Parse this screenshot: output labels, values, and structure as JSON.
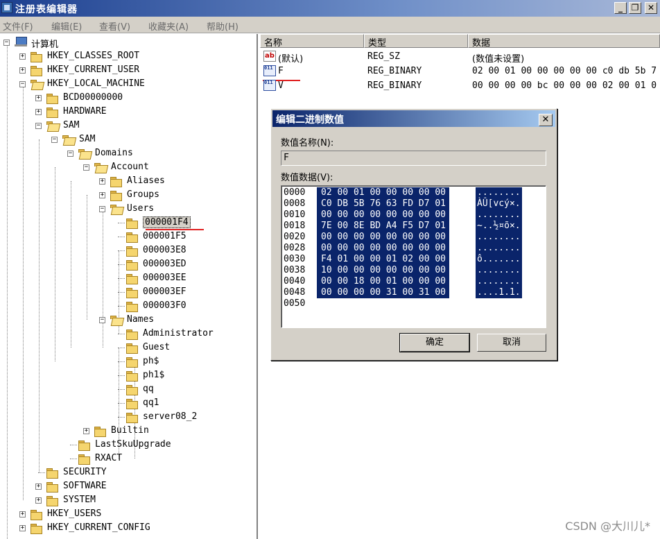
{
  "window": {
    "title": "注册表编辑器"
  },
  "menu": [
    {
      "label": "文件(F)"
    },
    {
      "label": "编辑(E)"
    },
    {
      "label": "查看(V)"
    },
    {
      "label": "收藏夹(A)"
    },
    {
      "label": "帮助(H)"
    }
  ],
  "tree": [
    {
      "label": "计算机",
      "icon": "computer-icon",
      "expander": "−"
    },
    {
      "label": "HKEY_CLASSES_ROOT",
      "icon": "folder-icon",
      "expander": "+"
    },
    {
      "label": "HKEY_CURRENT_USER",
      "icon": "folder-icon",
      "expander": "+"
    },
    {
      "label": "HKEY_LOCAL_MACHINE",
      "icon": "folder-icon",
      "expander": "−"
    },
    {
      "label": "BCD00000000",
      "icon": "folder-icon",
      "expander": "+"
    },
    {
      "label": "HARDWARE",
      "icon": "folder-icon",
      "expander": "+"
    },
    {
      "label": "SAM",
      "icon": "folder-icon",
      "expander": "−"
    },
    {
      "label": "SAM",
      "icon": "folder-icon",
      "expander": "−"
    },
    {
      "label": "Domains",
      "icon": "folder-icon",
      "expander": "−"
    },
    {
      "label": "Account",
      "icon": "folder-icon",
      "expander": "−"
    },
    {
      "label": "Aliases",
      "icon": "folder-icon",
      "expander": "+"
    },
    {
      "label": "Groups",
      "icon": "folder-icon",
      "expander": "+"
    },
    {
      "label": "Users",
      "icon": "folder-icon",
      "expander": "−"
    },
    {
      "label": "000001F4",
      "icon": "folder-icon",
      "expander": "",
      "selected": true
    },
    {
      "label": "000001F5",
      "icon": "folder-icon",
      "expander": ""
    },
    {
      "label": "000003E8",
      "icon": "folder-icon",
      "expander": ""
    },
    {
      "label": "000003ED",
      "icon": "folder-icon",
      "expander": ""
    },
    {
      "label": "000003EE",
      "icon": "folder-icon",
      "expander": ""
    },
    {
      "label": "000003EF",
      "icon": "folder-icon",
      "expander": ""
    },
    {
      "label": "000003F0",
      "icon": "folder-icon",
      "expander": ""
    },
    {
      "label": "Names",
      "icon": "folder-icon",
      "expander": "−"
    },
    {
      "label": "Administrator",
      "icon": "folder-icon",
      "expander": ""
    },
    {
      "label": "Guest",
      "icon": "folder-icon",
      "expander": ""
    },
    {
      "label": "ph$",
      "icon": "folder-icon",
      "expander": ""
    },
    {
      "label": "ph1$",
      "icon": "folder-icon",
      "expander": ""
    },
    {
      "label": "qq",
      "icon": "folder-icon",
      "expander": ""
    },
    {
      "label": "qq1",
      "icon": "folder-icon",
      "expander": ""
    },
    {
      "label": "server08_2",
      "icon": "folder-icon",
      "expander": ""
    },
    {
      "label": "Builtin",
      "icon": "folder-icon",
      "expander": "+"
    },
    {
      "label": "LastSkuUpgrade",
      "icon": "folder-icon",
      "expander": ""
    },
    {
      "label": "RXACT",
      "icon": "folder-icon",
      "expander": ""
    },
    {
      "label": "SECURITY",
      "icon": "folder-icon",
      "expander": ""
    },
    {
      "label": "SOFTWARE",
      "icon": "folder-icon",
      "expander": "+"
    },
    {
      "label": "SYSTEM",
      "icon": "folder-icon",
      "expander": "+"
    },
    {
      "label": "HKEY_USERS",
      "icon": "folder-icon",
      "expander": "+"
    },
    {
      "label": "HKEY_CURRENT_CONFIG",
      "icon": "folder-icon",
      "expander": "+"
    }
  ],
  "list": {
    "headers": {
      "name": "名称",
      "type": "类型",
      "data": "数据"
    },
    "rows": [
      {
        "icon": "string-value-icon",
        "icon_text": "ab",
        "name": "(默认)",
        "type": "REG_SZ",
        "data": "(数值未设置)"
      },
      {
        "icon": "binary-value-icon",
        "icon_text": "011 110",
        "name": "F",
        "type": "REG_BINARY",
        "data": "02 00 01 00 00 00 00 00 c0 db 5b 7"
      },
      {
        "icon": "binary-value-icon",
        "icon_text": "011 110",
        "name": "V",
        "type": "REG_BINARY",
        "data": "00 00 00 00 bc 00 00 00 02 00 01 0"
      }
    ]
  },
  "dialog": {
    "title": "编辑二进制数值",
    "close_label": "✕",
    "name_label": "数值名称(N):",
    "name_value": "F",
    "data_label": "数值数据(V):",
    "hex_rows": [
      {
        "offset": "0000",
        "bytes": "02 00 01 00 00 00 00 00",
        "ascii": "........"
      },
      {
        "offset": "0008",
        "bytes": "C0 DB 5B 76 63 FD D7 01",
        "ascii": "ÀÛ[vcý×."
      },
      {
        "offset": "0010",
        "bytes": "00 00 00 00 00 00 00 00",
        "ascii": "........"
      },
      {
        "offset": "0018",
        "bytes": "7E 00 8E BD A4 F5 D7 01",
        "ascii": "~..½¤õ×."
      },
      {
        "offset": "0020",
        "bytes": "00 00 00 00 00 00 00 00",
        "ascii": "........"
      },
      {
        "offset": "0028",
        "bytes": "00 00 00 00 00 00 00 00",
        "ascii": "........"
      },
      {
        "offset": "0030",
        "bytes": "F4 01 00 00 01 02 00 00",
        "ascii": "ô......."
      },
      {
        "offset": "0038",
        "bytes": "10 00 00 00 00 00 00 00",
        "ascii": "........"
      },
      {
        "offset": "0040",
        "bytes": "00 00 18 00 01 00 00 00",
        "ascii": "........"
      },
      {
        "offset": "0048",
        "bytes": "00 00 00 00 31 00 31 00",
        "ascii": "....1.1."
      },
      {
        "offset": "0050",
        "bytes": "",
        "ascii": ""
      }
    ],
    "ok_label": "确定",
    "cancel_label": "取消"
  },
  "watermark": "CSDN @大川儿*",
  "colors": {
    "selection": "#0a246a",
    "annotation": "#e02020",
    "title_bar": "#1c3f8f"
  }
}
